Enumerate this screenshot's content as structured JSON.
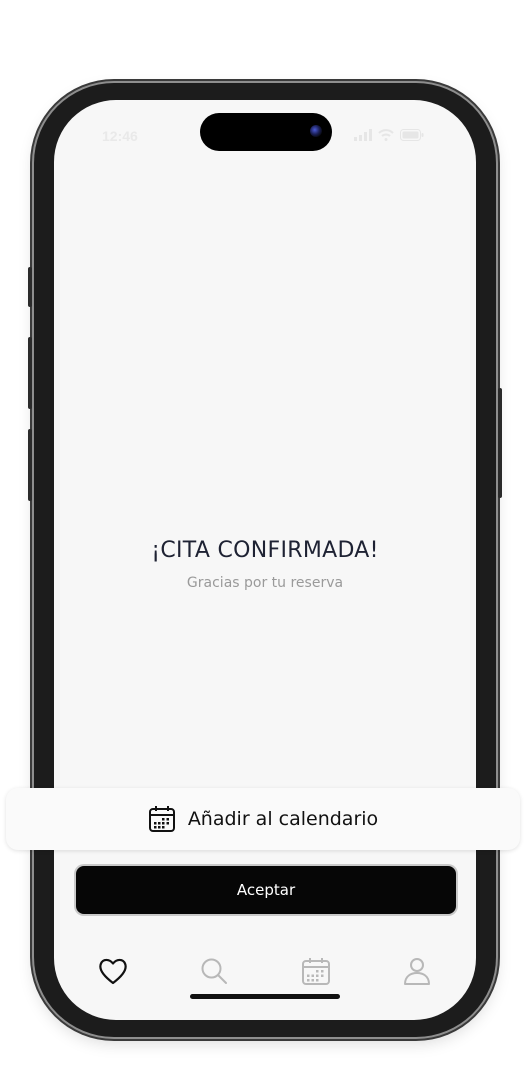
{
  "status_bar": {
    "time": "12:46",
    "icons": [
      "signal-icon",
      "wifi-icon",
      "battery-icon"
    ]
  },
  "confirmation": {
    "title": "¡CITA CONFIRMADA!",
    "subtitle": "Gracias por tu reserva"
  },
  "calendar_card": {
    "icon": "calendar-icon",
    "label": "Añadir al calendario"
  },
  "accept_button": {
    "label": "Aceptar"
  },
  "tab_bar": {
    "tabs": [
      {
        "icon": "heart-icon",
        "active": true
      },
      {
        "icon": "search-icon",
        "active": false
      },
      {
        "icon": "calendar-icon",
        "active": false
      },
      {
        "icon": "user-icon",
        "active": false
      }
    ]
  },
  "colors": {
    "screen_background": "#f7f7f7",
    "title_text": "#1e2233",
    "subtitle_text": "#9a9a9a",
    "button_background": "#060606",
    "inactive_tab_icon": "#b8b8b8",
    "active_tab_icon": "#111111"
  }
}
